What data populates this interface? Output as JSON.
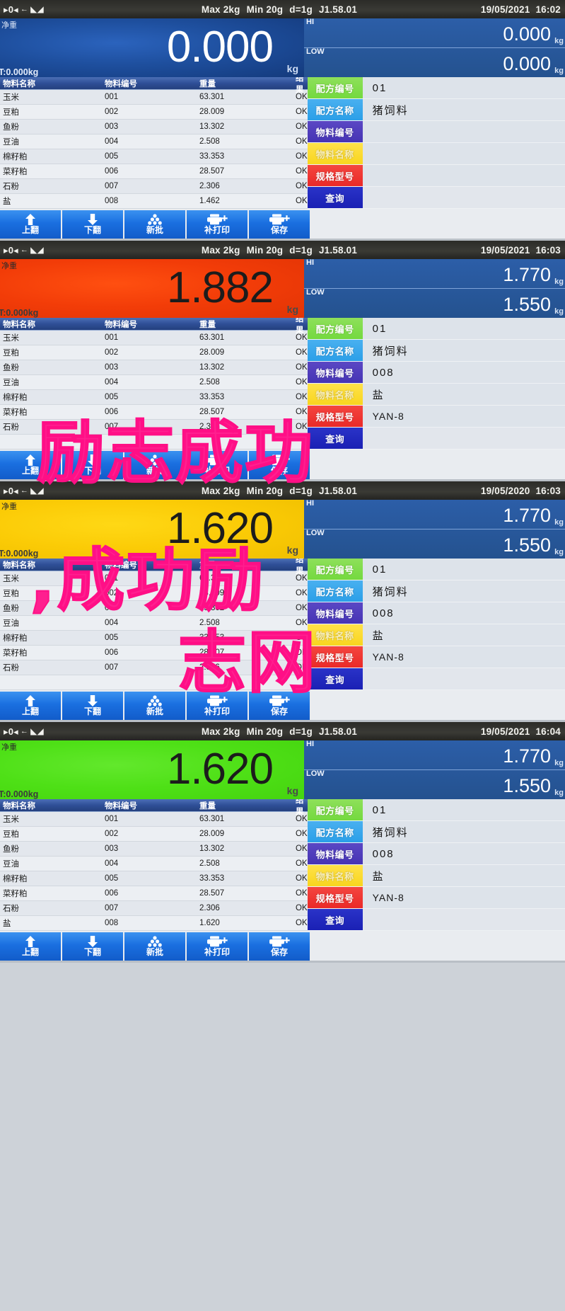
{
  "device": {
    "spec_max": "Max 2kg",
    "spec_min": "Min 20g",
    "spec_d": "d=1g",
    "firmware": "J1.58.01",
    "icon_zero": "zero-indicator-icon",
    "icon_tare": "tare-arrow-icon",
    "icon_stable": "stability-icon",
    "unit": "kg",
    "net_label": "净重",
    "hi_label": "HI",
    "low_label": "LOW"
  },
  "table": {
    "headers": [
      "物料名称",
      "物料编号",
      "重量",
      "结果"
    ]
  },
  "form": {
    "keys": {
      "recipe_no": "配方编号",
      "recipe_name": "配方名称",
      "material_no": "物料编号",
      "material_name": "物料名称",
      "spec_model": "规格型号",
      "query": "查询"
    },
    "colors": {
      "recipe_no": "#74d93f",
      "recipe_name": "#2b9fe8",
      "material_no": "#4634b4",
      "material_name": "#f8d51f",
      "spec_model": "#ea2a28",
      "query": "#1a20b4"
    }
  },
  "toolbar": {
    "buttons": [
      {
        "label": "上翻",
        "icon": "arrow-up-icon"
      },
      {
        "label": "下翻",
        "icon": "arrow-down-icon"
      },
      {
        "label": "新批",
        "icon": "batch-stack-icon"
      },
      {
        "label": "补打印",
        "icon": "printer-plus-icon"
      },
      {
        "label": "保存",
        "icon": "printer-plus-icon"
      }
    ]
  },
  "watermark": {
    "line1": "励志成功",
    "line2": ",成功励",
    "line3": "志网"
  },
  "panels": [
    {
      "id": "panel-1",
      "date": "19/05/2021",
      "time": "16:02",
      "weight": "0.000",
      "weight_color": "blue",
      "tare": "T:0.000kg",
      "hi": "0.000",
      "low": "0.000",
      "recipe_no": "01",
      "recipe_name": "猪饲料",
      "material_no": "",
      "material_name": "",
      "spec_model": "",
      "rows": [
        {
          "name": "玉米",
          "code": "001",
          "weight": "63.301",
          "result": "OK"
        },
        {
          "name": "豆粕",
          "code": "002",
          "weight": "28.009",
          "result": "OK"
        },
        {
          "name": "鱼粉",
          "code": "003",
          "weight": "13.302",
          "result": "OK"
        },
        {
          "name": "豆油",
          "code": "004",
          "weight": "2.508",
          "result": "OK"
        },
        {
          "name": "棉籽粕",
          "code": "005",
          "weight": "33.353",
          "result": "OK"
        },
        {
          "name": "菜籽粕",
          "code": "006",
          "weight": "28.507",
          "result": "OK"
        },
        {
          "name": "石粉",
          "code": "007",
          "weight": "2.306",
          "result": "OK"
        },
        {
          "name": "盐",
          "code": "008",
          "weight": "1.462",
          "result": "OK"
        }
      ]
    },
    {
      "id": "panel-2",
      "date": "19/05/2021",
      "time": "16:03",
      "weight": "1.882",
      "weight_color": "red",
      "tare": "T:0.000kg",
      "hi": "1.770",
      "low": "1.550",
      "recipe_no": "01",
      "recipe_name": "猪饲料",
      "material_no": "008",
      "material_name": "盐",
      "spec_model": "YAN-8",
      "rows": [
        {
          "name": "玉米",
          "code": "001",
          "weight": "63.301",
          "result": "OK"
        },
        {
          "name": "豆粕",
          "code": "002",
          "weight": "28.009",
          "result": "OK"
        },
        {
          "name": "鱼粉",
          "code": "003",
          "weight": "13.302",
          "result": "OK"
        },
        {
          "name": "豆油",
          "code": "004",
          "weight": "2.508",
          "result": "OK"
        },
        {
          "name": "棉籽粕",
          "code": "005",
          "weight": "33.353",
          "result": "OK"
        },
        {
          "name": "菜籽粕",
          "code": "006",
          "weight": "28.507",
          "result": "OK"
        },
        {
          "name": "石粉",
          "code": "007",
          "weight": "2.306",
          "result": "OK"
        },
        {
          "name": "",
          "code": "",
          "weight": "",
          "result": ""
        }
      ]
    },
    {
      "id": "panel-3",
      "date": "19/05/2020",
      "time": "16:03",
      "weight": "1.620",
      "weight_color": "yellow",
      "tare": "T:0.000kg",
      "hi": "1.770",
      "low": "1.550",
      "recipe_no": "01",
      "recipe_name": "猪饲料",
      "material_no": "008",
      "material_name": "盐",
      "spec_model": "YAN-8",
      "rows": [
        {
          "name": "玉米",
          "code": "001",
          "weight": "63.301",
          "result": "OK"
        },
        {
          "name": "豆粕",
          "code": "002",
          "weight": "28.009",
          "result": "OK"
        },
        {
          "name": "鱼粉",
          "code": "003",
          "weight": "13.302",
          "result": "OK"
        },
        {
          "name": "豆油",
          "code": "004",
          "weight": "2.508",
          "result": "OK"
        },
        {
          "name": "棉籽粕",
          "code": "005",
          "weight": "33.353",
          "result": "OK"
        },
        {
          "name": "菜籽粕",
          "code": "006",
          "weight": "28.507",
          "result": "OK"
        },
        {
          "name": "石粉",
          "code": "007",
          "weight": "2.306",
          "result": "OK"
        },
        {
          "name": "",
          "code": "",
          "weight": "",
          "result": ""
        }
      ]
    },
    {
      "id": "panel-4",
      "date": "19/05/2021",
      "time": "16:04",
      "weight": "1.620",
      "weight_color": "green",
      "tare": "T:0.000kg",
      "hi": "1.770",
      "low": "1.550",
      "recipe_no": "01",
      "recipe_name": "猪饲料",
      "material_no": "008",
      "material_name": "盐",
      "spec_model": "YAN-8",
      "rows": [
        {
          "name": "玉米",
          "code": "001",
          "weight": "63.301",
          "result": "OK"
        },
        {
          "name": "豆粕",
          "code": "002",
          "weight": "28.009",
          "result": "OK"
        },
        {
          "name": "鱼粉",
          "code": "003",
          "weight": "13.302",
          "result": "OK"
        },
        {
          "name": "豆油",
          "code": "004",
          "weight": "2.508",
          "result": "OK"
        },
        {
          "name": "棉籽粕",
          "code": "005",
          "weight": "33.353",
          "result": "OK"
        },
        {
          "name": "菜籽粕",
          "code": "006",
          "weight": "28.507",
          "result": "OK"
        },
        {
          "name": "石粉",
          "code": "007",
          "weight": "2.306",
          "result": "OK"
        },
        {
          "name": "盐",
          "code": "008",
          "weight": "1.620",
          "result": "OK"
        }
      ]
    }
  ]
}
